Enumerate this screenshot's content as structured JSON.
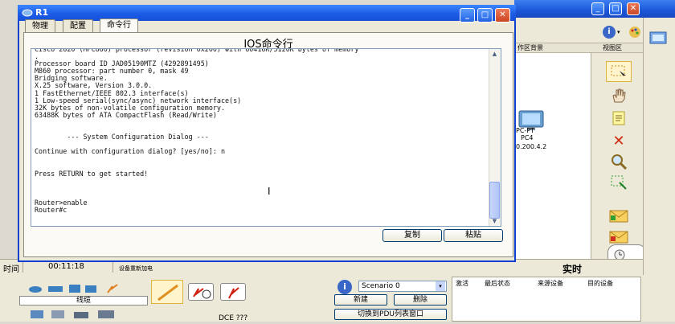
{
  "background_window": {
    "header_left": "作区背景",
    "header_right": "视图区",
    "device_name": "PC4",
    "device_type": "PC-PT",
    "device_ip": "0.200.4.2"
  },
  "dialog": {
    "title": "R1",
    "tabs": [
      {
        "label": "物理"
      },
      {
        "label": "配置"
      },
      {
        "label": "命令行"
      }
    ],
    "active_tab": "命令行",
    "panel_title": "IOS命令行",
    "console_text": "Cisco 2620 (MPC860) processor (revision 0x200) with 60416K/5120K bytes of memory\n.\nProcessor board ID JAD05190MTZ (4292891495)\nM860 processor: part number 0, mask 49\nBridging software.\nX.25 software, Version 3.0.0.\n1 FastEthernet/IEEE 802.3 interface(s)\n1 Low-speed serial(sync/async) network interface(s)\n32K bytes of non-volatile configuration memory.\n63488K bytes of ATA CompactFlash (Read/Write)\n\n\n        --- System Configuration Dialog ---\n\nContinue with configuration dialog? [yes/no]: n\n\n\nPress RETURN to get started!\n\n\n\nRouter>enable\nRouter#c",
    "copy_label": "复制",
    "paste_label": "粘贴"
  },
  "statusbar": {
    "time_label": "时间",
    "time_value": "00:11:18",
    "power_label": "设备重新加电",
    "realtime_label": "实时"
  },
  "scenario": {
    "selected": "Scenario 0",
    "new_label": "新建",
    "delete_label": "删除",
    "switch_label": "切换到PDU列表窗口"
  },
  "pdu_table": {
    "columns": [
      "激活",
      "最后状态",
      "来源设备",
      "目的设备"
    ]
  },
  "device_panel": {
    "category_label": "线缆",
    "cable_label": "DCE ???"
  },
  "colors": {
    "titlebar": "#1c5ce6",
    "console_bg": "#ffffff"
  }
}
